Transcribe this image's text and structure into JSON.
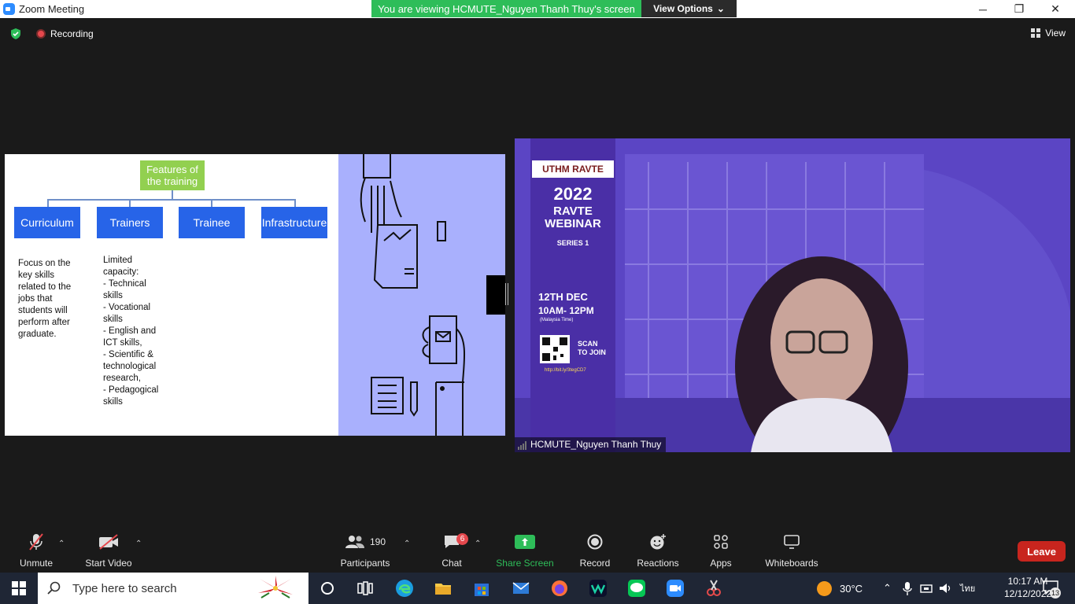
{
  "window": {
    "title": "Zoom Meeting",
    "minimize": "─",
    "restore": "❐",
    "close": "✕"
  },
  "share_banner": {
    "text": "You are viewing HCMUTE_Nguyen Thanh Thuy's screen",
    "view_options": "View Options"
  },
  "meeting_bar": {
    "recording": "Recording",
    "view": "View"
  },
  "slide": {
    "root": "Features of the training",
    "branches": [
      "Curriculum",
      "Trainers",
      "Trainee",
      "Infrastructure"
    ],
    "curriculum_desc": "Focus on the\nkey skills\nrelated to the\njobs that\nstudents will\nperform after\ngraduate.",
    "trainers_desc": "Limited\ncapacity:\n- Technical\nskills\n- Vocational\nskills\n- English and\nICT skills,\n- Scientific &\ntechnological\nresearch,\n- Pedagogical\nskills"
  },
  "video": {
    "speaker": "HCMUTE_Nguyen Thanh Thuy",
    "poster": {
      "logo": "UTHM  RAVTE",
      "year": "2022",
      "line1": "RAVTE",
      "line2": "WEBINAR",
      "series": "SERIES 1",
      "date": "12TH DEC",
      "time": "10AM- 12PM",
      "tz": "(Malaysia Time)",
      "scan": "SCAN\nTO JOIN",
      "link": "http://bit.ly/3tegCD7"
    }
  },
  "toolbar": {
    "unmute": "Unmute",
    "start_video": "Start Video",
    "participants": "Participants",
    "participants_count": "190",
    "chat": "Chat",
    "chat_badge": "6",
    "share_screen": "Share Screen",
    "record": "Record",
    "reactions": "Reactions",
    "apps": "Apps",
    "whiteboards": "Whiteboards",
    "leave": "Leave"
  },
  "taskbar": {
    "search_placeholder": "Type here to search",
    "temperature": "30°C",
    "lang": "ไทย",
    "time": "10:17 AM",
    "date": "12/12/2022",
    "notifications": "13"
  },
  "colors": {
    "share_green": "#2ebd59",
    "leave_red": "#c8251e",
    "branch_blue": "#2764e8",
    "root_green": "#92d050",
    "slide_panel": "#a9b0fd"
  }
}
